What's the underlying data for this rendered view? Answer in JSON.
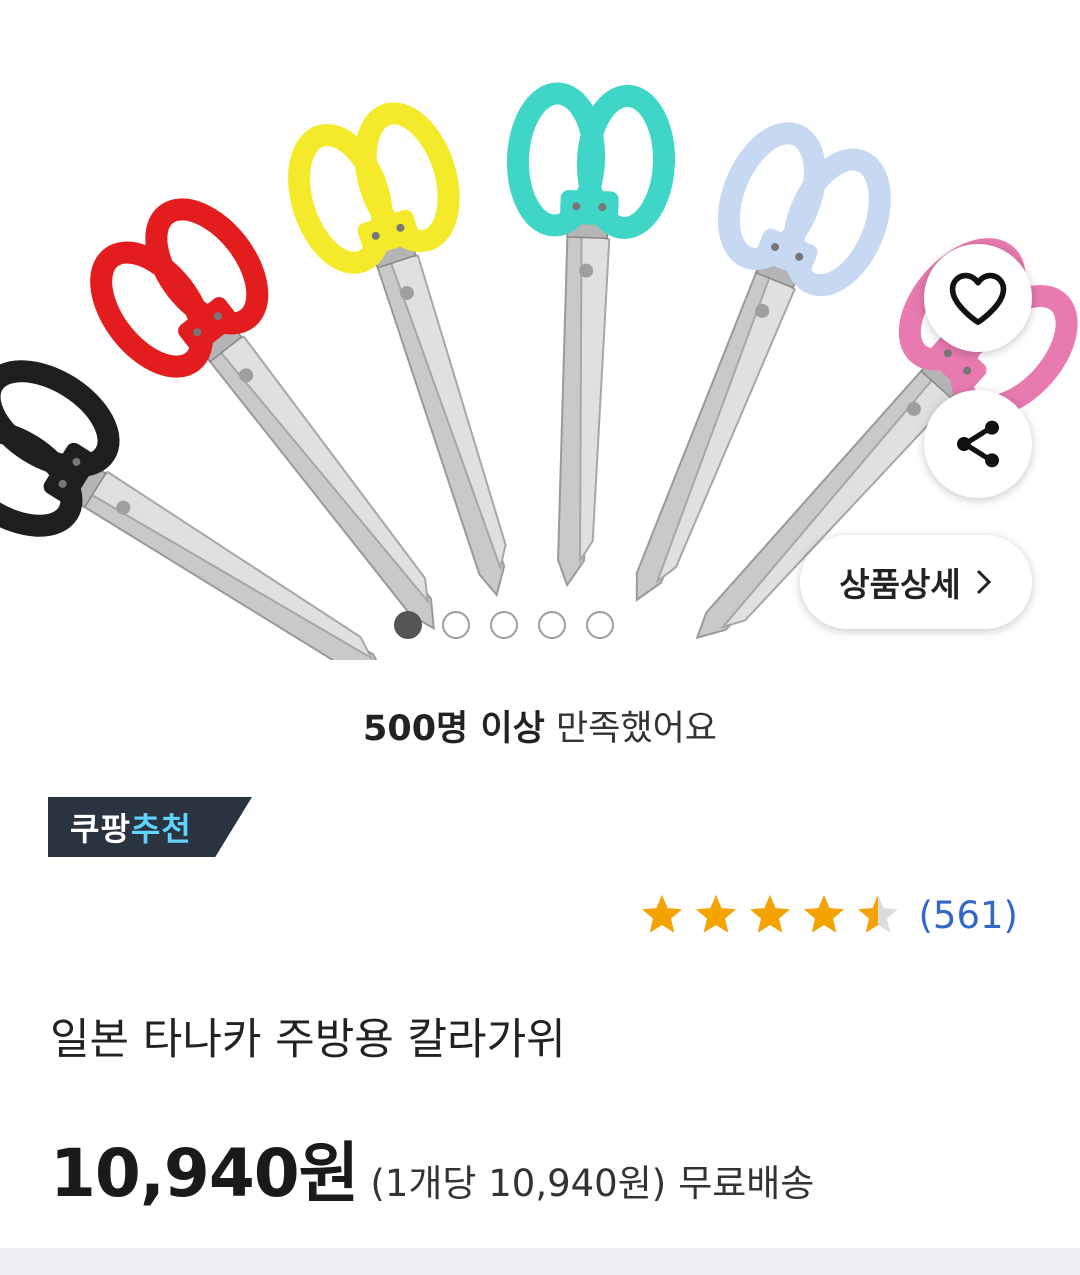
{
  "gallery": {
    "image_alt": "일본 타나카 주방용 칼라가위",
    "scissor_colors": [
      "#1e1e1e",
      "#e31d1d",
      "#f5ea2a",
      "#3fd6c8",
      "#c7d8f2",
      "#e87ab0"
    ],
    "slide_count": 5,
    "active_slide": 1,
    "detail_button_label": "상품상세"
  },
  "satisfaction": {
    "bold": "500명 이상",
    "text": " 만족했어요"
  },
  "badge": {
    "prefix": "쿠팡",
    "accent": "추천"
  },
  "rating": {
    "value": 4.5,
    "max": 5,
    "count_text": "(561)",
    "star_color": "#f5a300"
  },
  "product": {
    "title": "일본 타나카 주방용 칼라가위",
    "price": "10,940원",
    "unit_price": "(1개당 10,940원)",
    "shipping": "무료배송"
  }
}
